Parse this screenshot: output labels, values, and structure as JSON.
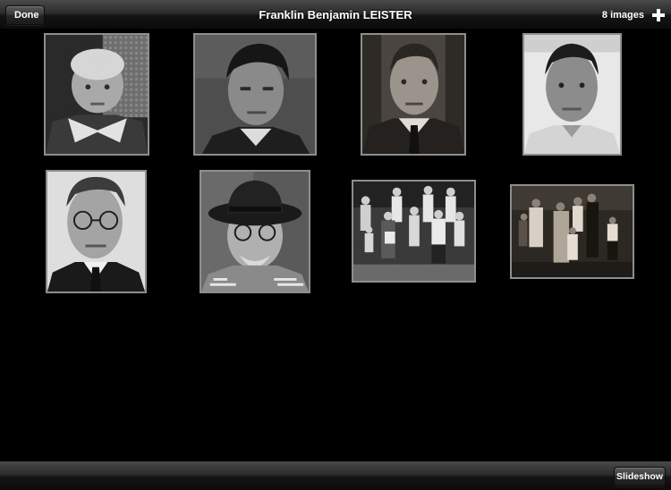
{
  "header": {
    "done_label": "Done",
    "title": "Franklin Benjamin LEISTER",
    "image_count": "8 images",
    "add_icon": "plus-icon"
  },
  "photos": [
    {
      "kind": "portrait",
      "subject": "boy"
    },
    {
      "kind": "portrait",
      "subject": "young-man"
    },
    {
      "kind": "portrait",
      "subject": "man-tie"
    },
    {
      "kind": "portrait",
      "subject": "man-shirt"
    },
    {
      "kind": "portrait",
      "subject": "man-glasses"
    },
    {
      "kind": "portrait",
      "subject": "old-man-hat"
    },
    {
      "kind": "group",
      "subject": "family-group"
    },
    {
      "kind": "group",
      "subject": "family-group-sepia"
    }
  ],
  "footer": {
    "slideshow_label": "Slideshow"
  },
  "colors": {
    "bar_dark": "#0b0b0b",
    "bar_light": "#4a4a4a",
    "frame": "#8e8e8e",
    "background": "#000000"
  }
}
